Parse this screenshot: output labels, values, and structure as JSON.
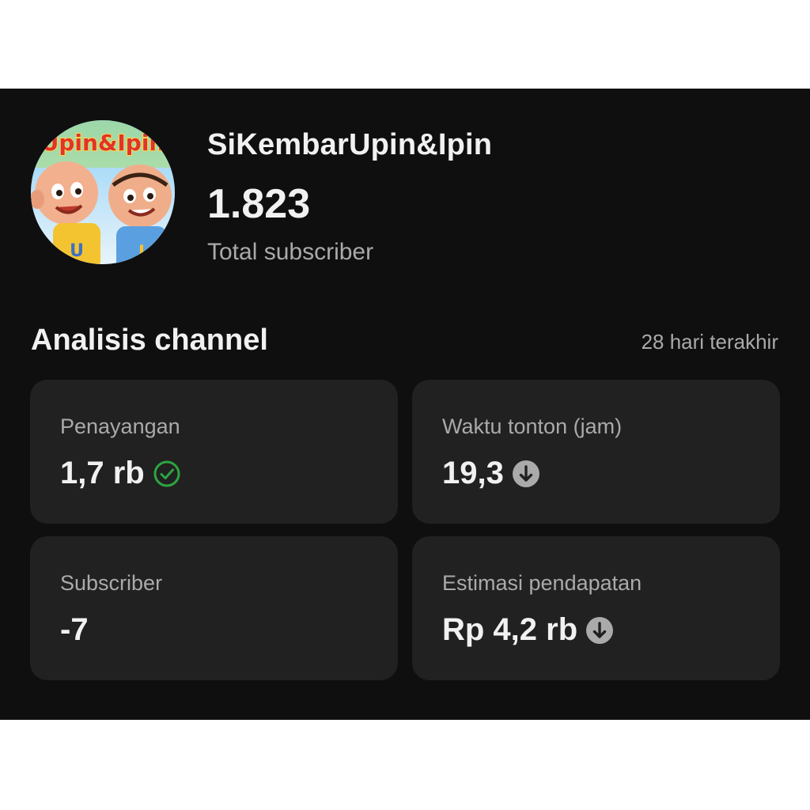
{
  "channel": {
    "name": "SiKembarUpin&Ipin",
    "subscriber_count": "1.823",
    "subscriber_caption": "Total subscriber",
    "avatar": {
      "icon": "channel-avatar",
      "logo_text": "Upin&Ipin"
    }
  },
  "analytics": {
    "title": "Analisis channel",
    "period": "28 hari terakhir",
    "cards": [
      {
        "label": "Penayangan",
        "value": "1,7 rb",
        "status_icon": "check-circle-icon",
        "status_color": "#2ba640"
      },
      {
        "label": "Waktu tonton (jam)",
        "value": "19,3",
        "status_icon": "arrow-down-circle-icon",
        "status_color": "#aaaaaa"
      },
      {
        "label": "Subscriber",
        "value": "-7",
        "status_icon": null
      },
      {
        "label": "Estimasi pendapatan",
        "value": "Rp 4,2 rb",
        "status_icon": "arrow-down-circle-icon",
        "status_color": "#aaaaaa"
      }
    ]
  },
  "colors": {
    "background": "#0f0f0f",
    "card": "#212121",
    "primary_text": "#f1f1f1",
    "secondary_text": "#aaaaaa",
    "positive": "#2ba640"
  }
}
